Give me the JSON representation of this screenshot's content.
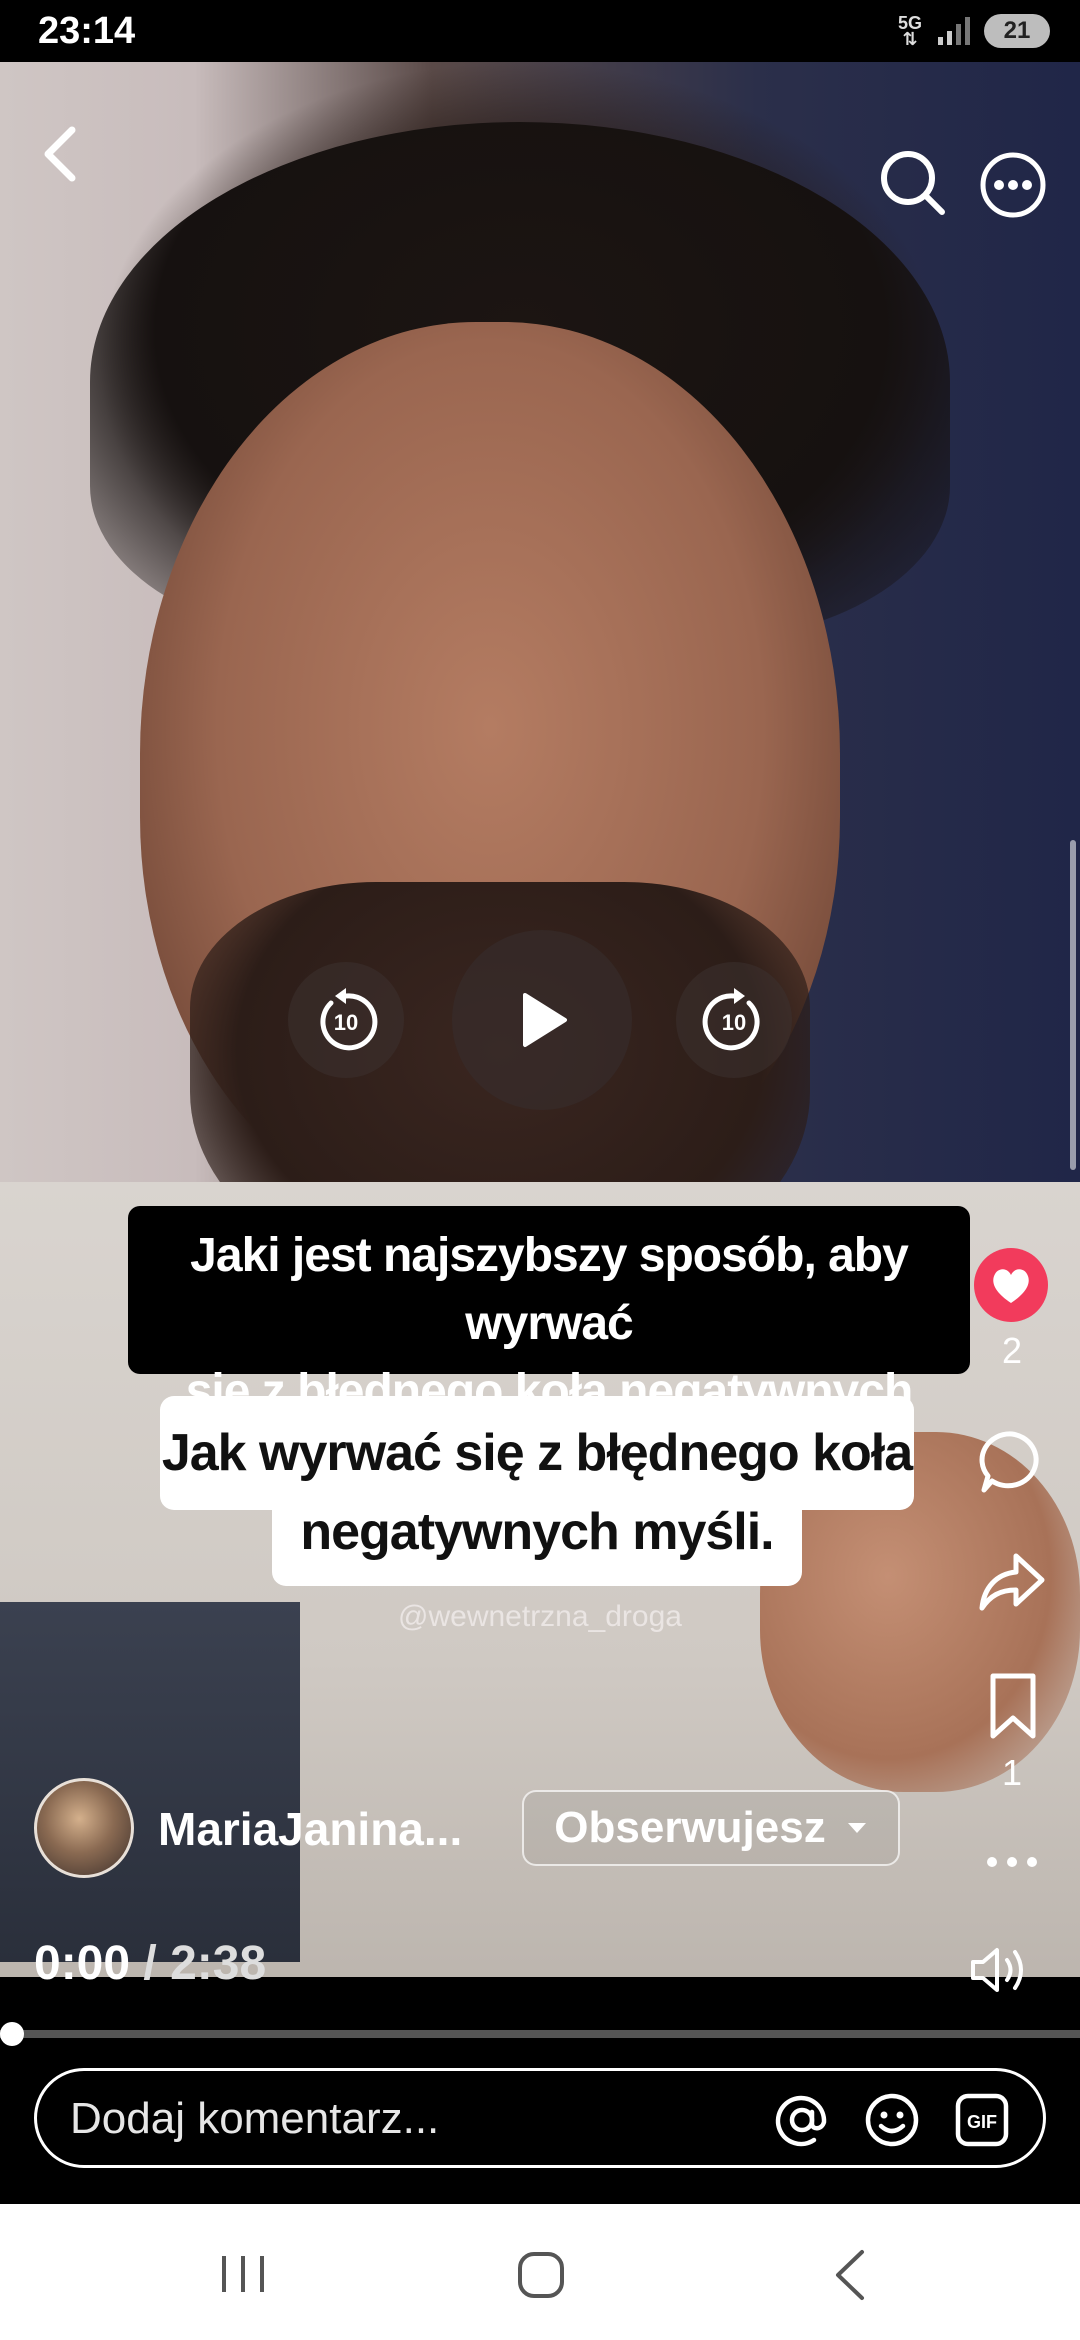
{
  "status_bar": {
    "time": "23:14",
    "network": "5G",
    "battery": "21"
  },
  "post": {
    "caption_question_line1": "Jaki jest najszybszy sposób, aby wyrwać",
    "caption_question_line2": "się z błędnego koła negatywnych myśli?",
    "caption_answer_line1": "Jak wyrwać się z błędnego koła",
    "caption_answer_line2": "negatywnych myśli.",
    "watermark": "@wewnetrzna_droga",
    "author": "MariaJanina...",
    "follow_label": "Obserwujesz",
    "like_count": "2",
    "save_count": "1"
  },
  "playback": {
    "current_time": "0:00",
    "separator": "/",
    "duration": "2:38",
    "skip_seconds": "10",
    "progress_fraction": 0.0
  },
  "comment_bar": {
    "placeholder": "Dodaj komentarz...",
    "gif_label": "GIF"
  },
  "icons": {
    "back": "chevron-left-icon",
    "search": "search-icon",
    "more": "more-horizontal-icon",
    "like": "heart-icon",
    "comment": "comment-bubble-icon",
    "share": "share-arrow-icon",
    "save": "bookmark-icon",
    "volume": "volume-icon"
  },
  "colors": {
    "like_accent": "#f23b5c",
    "nav_background": "#ffffff"
  }
}
